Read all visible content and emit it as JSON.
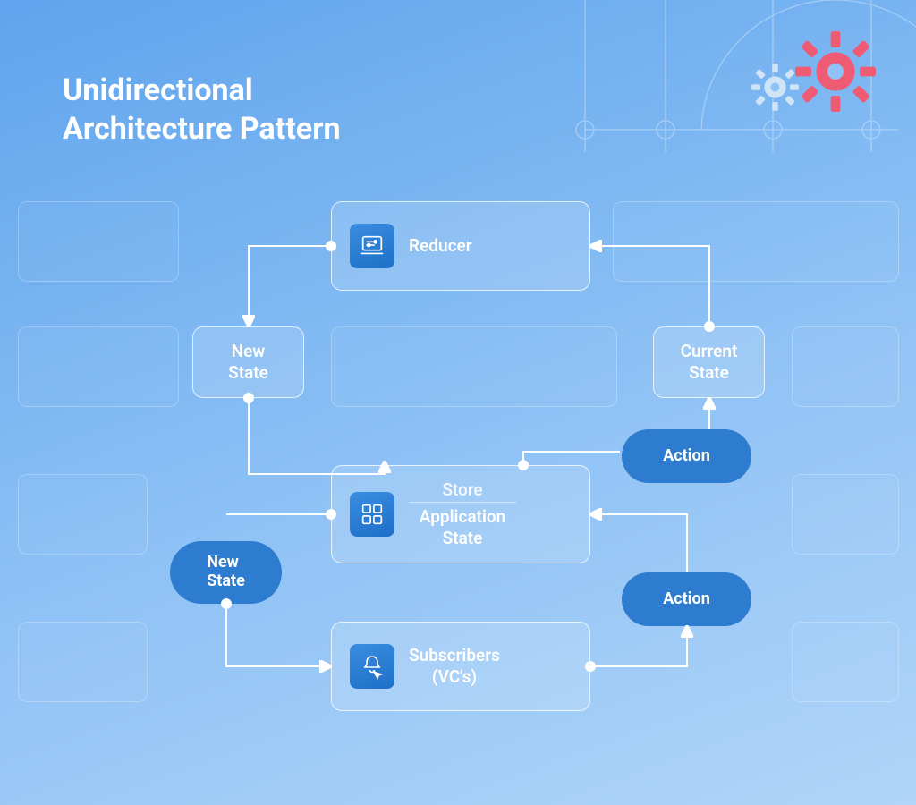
{
  "title_line1": "Unidirectional",
  "title_line2": "Architecture Pattern",
  "nodes": {
    "reducer": "Reducer",
    "new_state_top": "New\nState",
    "current_state": "Current\nState",
    "action_top": "Action",
    "store_top": "Store",
    "store_bottom": "Application\nState",
    "new_state_bottom": "New\nState",
    "action_bottom": "Action",
    "subscribers": "Subscribers\n(VC's)"
  },
  "icons": {
    "reducer": "laptop-sliders-icon",
    "store": "grid-icon",
    "subscribers": "bell-cursor-icon"
  },
  "colors": {
    "pill": "#2d7cd0",
    "gear_accent": "#f05b74",
    "gear_light": "#cfe4f7"
  }
}
